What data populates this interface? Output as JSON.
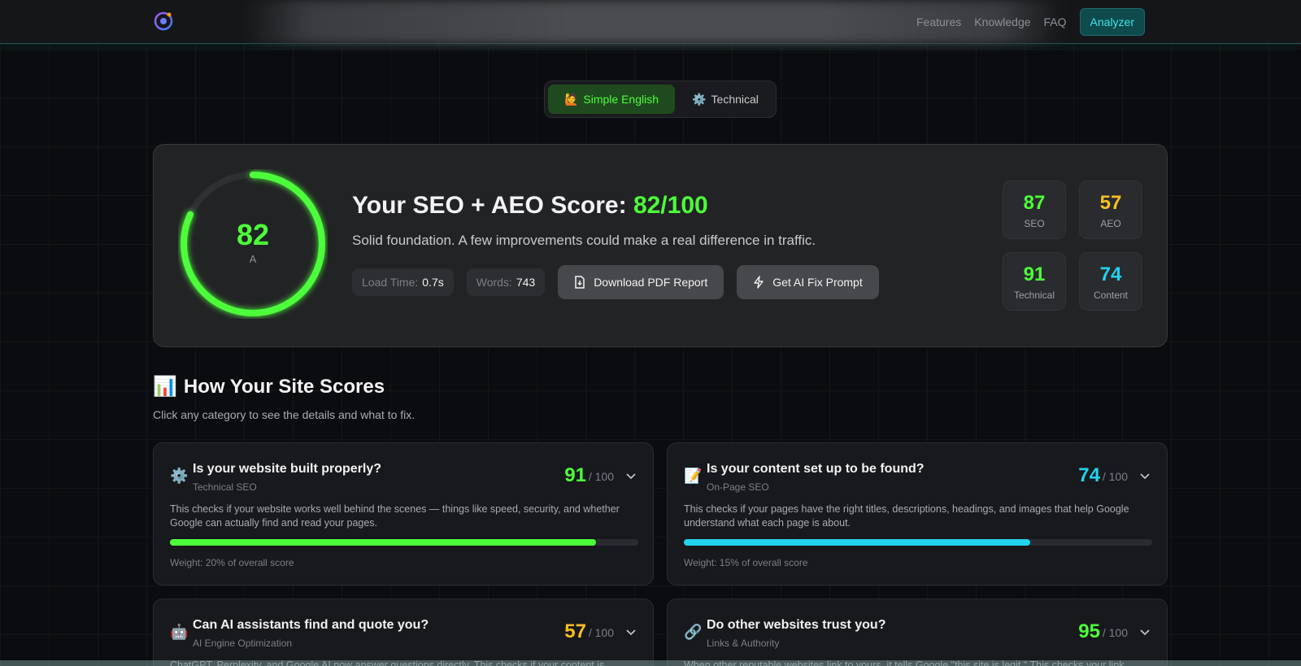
{
  "nav": {
    "links": [
      "Features",
      "Knowledge",
      "FAQ"
    ],
    "cta": "Analyzer",
    "accent": "#2dd4bf"
  },
  "mode_toggle": {
    "active": {
      "icon": "🙋",
      "label": "Simple English"
    },
    "inactive": {
      "icon": "⚙️",
      "label": "Technical"
    }
  },
  "score": {
    "value": 82,
    "grade": "A",
    "fraction": 0.82,
    "title_prefix": "Your SEO + AEO Score: ",
    "title_value": "82/100",
    "subtitle": "Solid foundation. A few improvements could make a real difference in traffic.",
    "load_time_label": "Load Time:",
    "load_time": "0.7s",
    "words_label": "Words:",
    "words": "743",
    "download_label": "Download PDF Report",
    "ai_fix_label": "Get AI Fix Prompt",
    "color": "#4dff3a"
  },
  "mini_scores": [
    {
      "value": "87",
      "label": "SEO",
      "color": "#4dff3a"
    },
    {
      "value": "57",
      "label": "AEO",
      "color": "#fbbf24"
    },
    {
      "value": "91",
      "label": "Technical",
      "color": "#4dff3a"
    },
    {
      "value": "74",
      "label": "Content",
      "color": "#22d3ee"
    }
  ],
  "section": {
    "icon": "📊",
    "title": "How Your Site Scores",
    "subtitle": "Click any category to see the details and what to fix."
  },
  "categories": [
    {
      "icon": "⚙️",
      "title": "Is your website built properly?",
      "tag": "Technical SEO",
      "score": "91",
      "max": "/ 100",
      "fraction": 0.91,
      "color": "#4dff3a",
      "desc": "This checks if your website works well behind the scenes — things like speed, security, and whether Google can actually find and read your pages.",
      "weight": "Weight: 20% of overall score"
    },
    {
      "icon": "📝",
      "title": "Is your content set up to be found?",
      "tag": "On-Page SEO",
      "score": "74",
      "max": "/ 100",
      "fraction": 0.74,
      "color": "#22d3ee",
      "desc": "This checks if your pages have the right titles, descriptions, headings, and images that help Google understand what each page is about.",
      "weight": "Weight: 15% of overall score"
    },
    {
      "icon": "🤖",
      "title": "Can AI assistants find and quote you?",
      "tag": "AI Engine Optimization",
      "score": "57",
      "max": "/ 100",
      "color": "#fbbf24",
      "desc": "ChatGPT, Perplexity, and Google AI now answer questions directly. This checks if your content is"
    },
    {
      "icon": "🔗",
      "title": "Do other websites trust you?",
      "tag": "Links & Authority",
      "score": "95",
      "max": "/ 100",
      "color": "#4dff3a",
      "desc": "When other reputable websites link to yours, it tells Google \"this site is legit.\" This checks your link"
    }
  ]
}
